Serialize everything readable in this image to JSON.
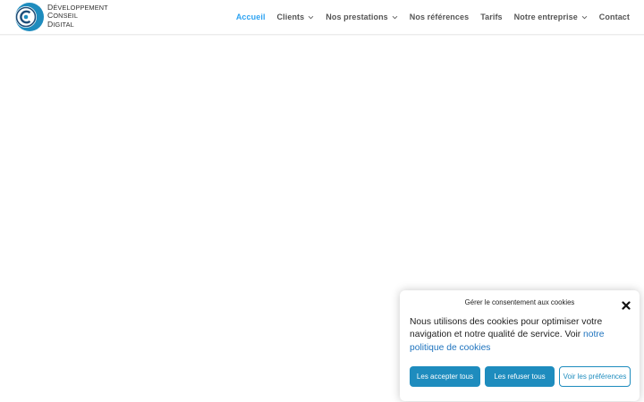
{
  "brand": {
    "line1": "Développement",
    "line2": "Conseil",
    "line3": "Digital",
    "colors": {
      "primary": "#1e8cbe",
      "dark": "#1f4e79",
      "accent": "#2ea3f2"
    }
  },
  "nav": {
    "items": [
      {
        "label": "Accueil",
        "active": true,
        "has_dropdown": false
      },
      {
        "label": "Clients",
        "active": false,
        "has_dropdown": true
      },
      {
        "label": "Nos prestations",
        "active": false,
        "has_dropdown": true
      },
      {
        "label": "Nos références",
        "active": false,
        "has_dropdown": false
      },
      {
        "label": "Tarifs",
        "active": false,
        "has_dropdown": false
      },
      {
        "label": "Notre entreprise",
        "active": false,
        "has_dropdown": true
      },
      {
        "label": "Contact",
        "active": false,
        "has_dropdown": false
      }
    ]
  },
  "cookie_banner": {
    "title": "Gérer le consentement aux cookies",
    "message": "Nous utilisons des cookies pour optimiser votre navigation et notre qualité de service. Voir ",
    "link_label": "notre politique de cookies",
    "accept_label": "Les accepter tous",
    "refuse_label": "Les refuser tous",
    "prefs_label": "Voir les préférences",
    "close_icon": "close-icon"
  }
}
